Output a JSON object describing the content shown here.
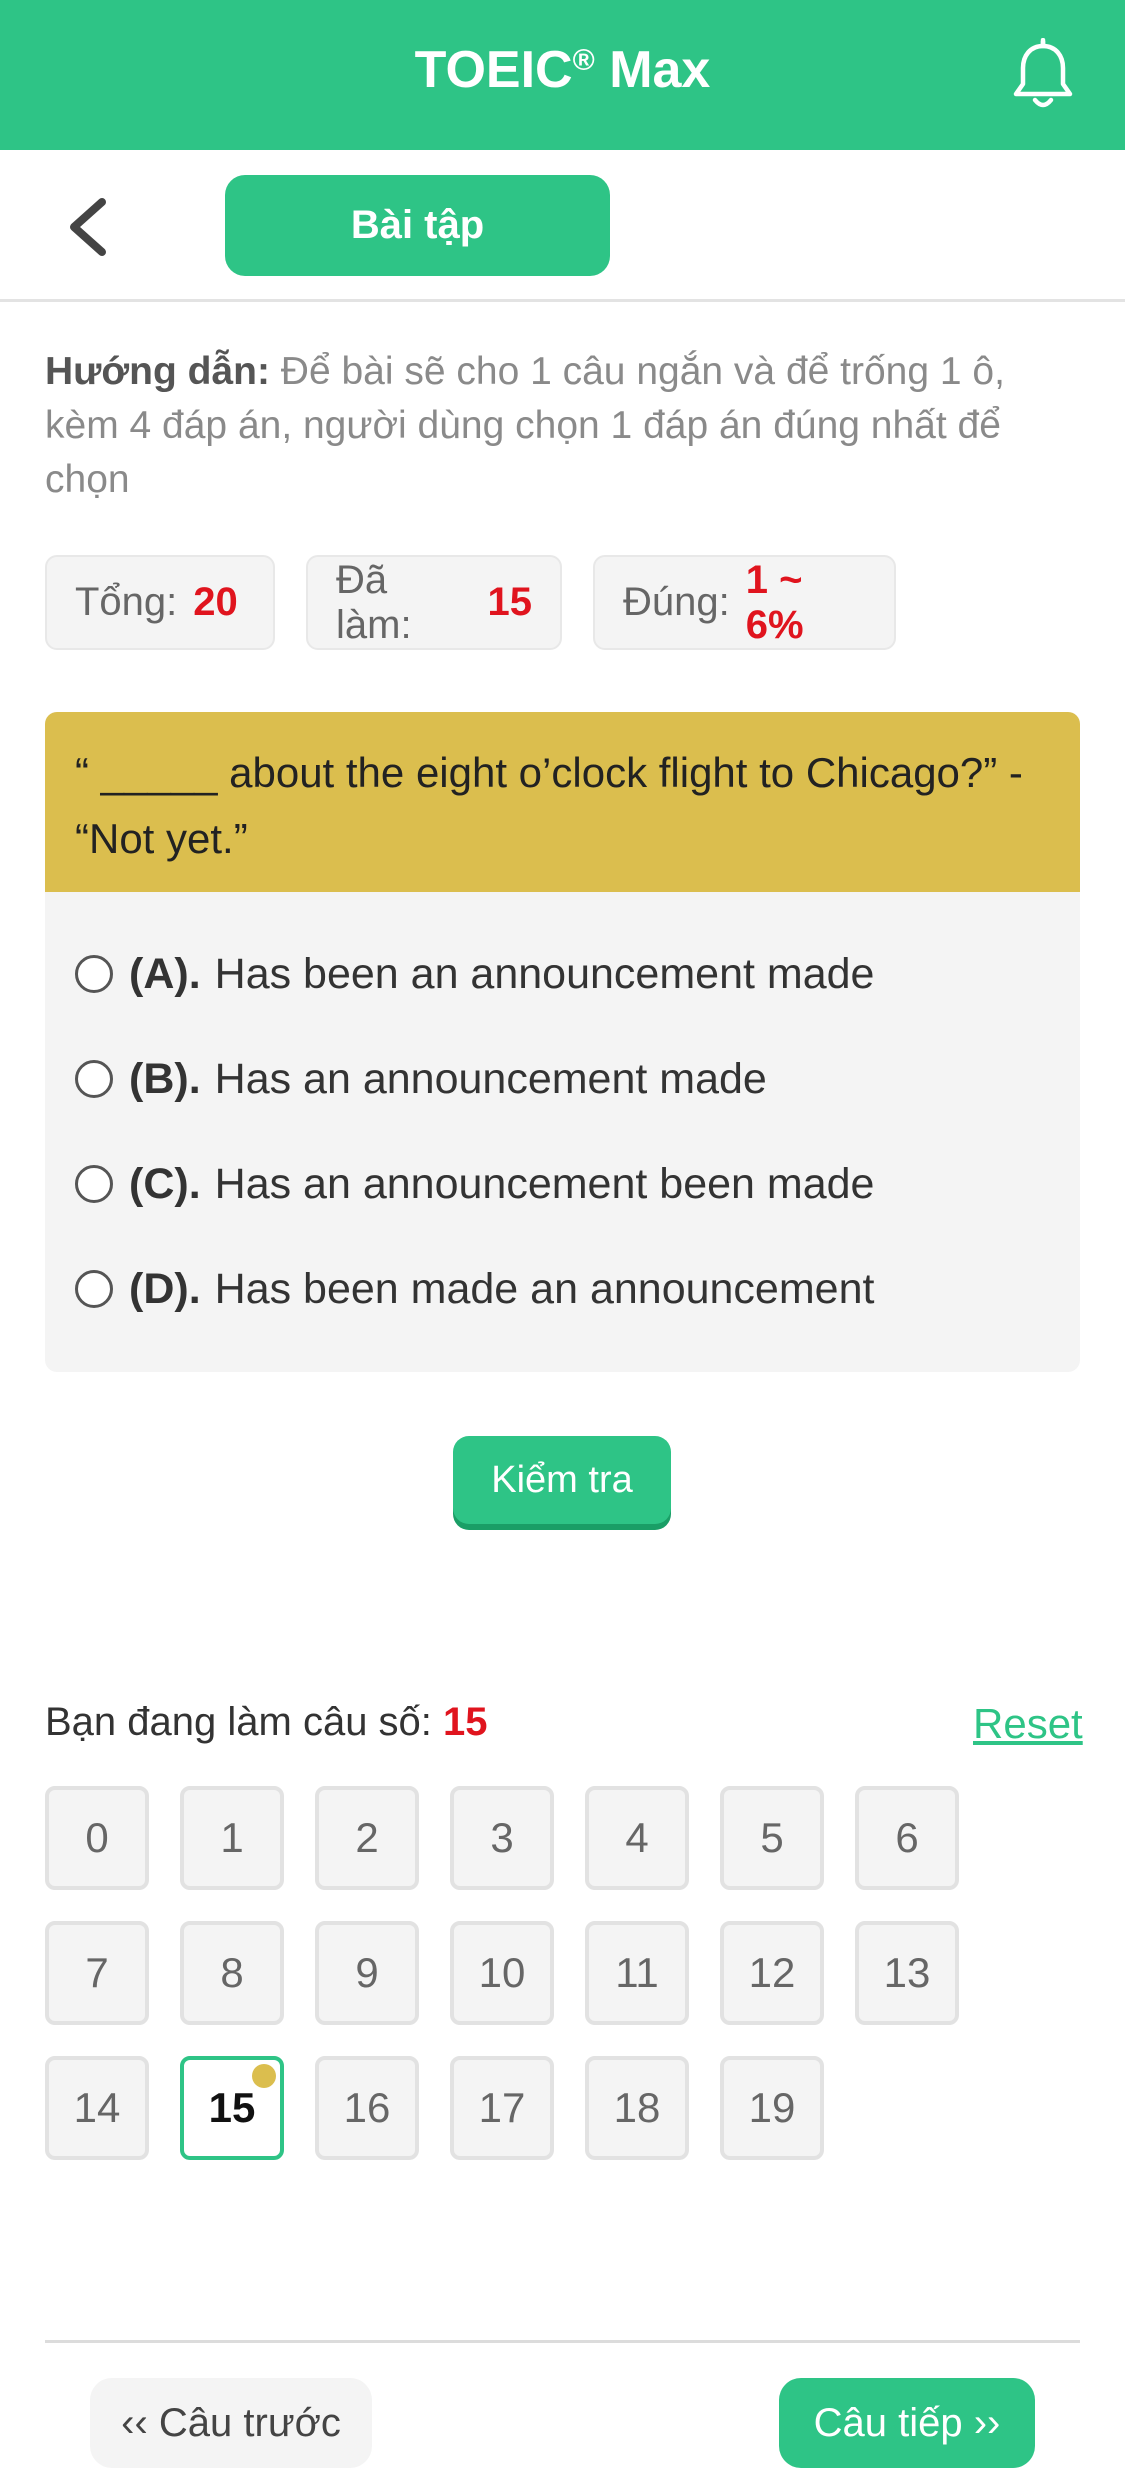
{
  "header": {
    "title": "TOEIC",
    "title_mark": "®",
    "title_suffix": "Max",
    "bell_icon": "bell-icon"
  },
  "subheader": {
    "back_icon": "chevron-left-icon",
    "tab_label": "Bài tập"
  },
  "instructions": {
    "label": "Hướng dẫn:",
    "text": "Để bài sẽ cho 1 câu ngắn và để trống 1 ô, kèm 4 đáp án, người dùng chọn 1 đáp án đúng nhất để chọn"
  },
  "stats": [
    {
      "label": "Tổng:",
      "value": "20"
    },
    {
      "label": "Đã làm:",
      "value": "15"
    },
    {
      "label": "Đúng:",
      "value": "1 ~ 6%"
    }
  ],
  "question": {
    "text": "“ _____ about the eight o’clock flight to Chicago?” - “Not yet.”",
    "options": [
      {
        "letter": "(A).",
        "text": "Has been an announcement made"
      },
      {
        "letter": "(B).",
        "text": "Has an announcement made"
      },
      {
        "letter": "(C).",
        "text": "Has an announcement been made"
      },
      {
        "letter": "(D).",
        "text": "Has been made an announcement"
      }
    ]
  },
  "check_button": "Kiểm tra",
  "progress": {
    "label": "Bạn đang làm câu số:",
    "current": "15",
    "reset": "Reset"
  },
  "question_numbers": [
    "0",
    "1",
    "2",
    "3",
    "4",
    "5",
    "6",
    "7",
    "8",
    "9",
    "10",
    "11",
    "12",
    "13",
    "14",
    "15",
    "16",
    "17",
    "18",
    "19"
  ],
  "current_index": 15,
  "navigation": {
    "prev": "‹‹ Câu trước",
    "next": "Câu tiếp ››"
  },
  "colors": {
    "brand_green": "#2ec486",
    "question_gold": "#dbbe4e",
    "accent_red": "#e0141e"
  }
}
